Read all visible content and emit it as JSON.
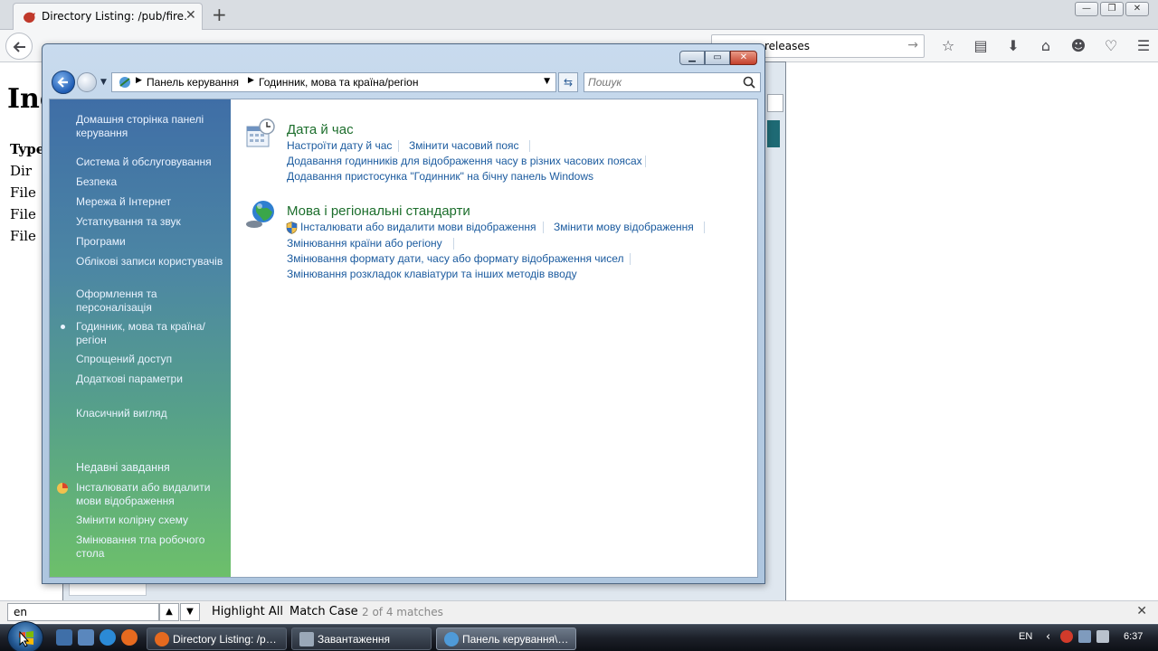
{
  "firefox": {
    "tab_title": "Directory Listing: /pub/fire…",
    "search_text": "releases",
    "page_heading": "Inc",
    "page_type_header": "Type",
    "rows": [
      "Dir",
      "File",
      "File",
      "File"
    ],
    "findbar": {
      "query": "en",
      "highlight_all": "Highlight All",
      "match_case": "Match Case",
      "status": "2 of 4 matches"
    }
  },
  "control_panel": {
    "breadcrumb": [
      "Панель керування",
      "Годинник, мова та країна/регіон"
    ],
    "search_placeholder": "Пошук",
    "sidebar": {
      "home": "Домашня сторінка панелі керування",
      "items": [
        "Система й обслуговування",
        "Безпека",
        "Мережа й Інтернет",
        "Устаткування та звук",
        "Програми",
        "Облікові записи користувачів",
        "Оформлення та персоналізація",
        "Годинник, мова та країна/регіон",
        "Спрощений доступ",
        "Додаткові параметри"
      ],
      "current_index": 7,
      "classic_view": "Класичний вигляд",
      "recent_tasks_header": "Недавні завдання",
      "recent_tasks": [
        "Інсталювати або видалити мови відображення",
        "Змінити колірну схему",
        "Змінювання тла робочого стола"
      ]
    },
    "categories": [
      {
        "title": "Дата й час",
        "icon": "calendar-clock-icon",
        "links": [
          "Настроїти дату й час",
          "Змінити часовий пояс",
          "Додавання годинників для відображення часу в різних часових поясах",
          "Додавання пристосунка \"Годинник\" на бічну панель Windows"
        ]
      },
      {
        "title": "Мова і регіональні стандарти",
        "icon": "globe-icon",
        "links": [
          "Інсталювати або видалити мови відображення",
          "Змінити мову відображення",
          "Змінювання країни або регіону",
          "Змінювання формату дати, часу або формату відображення чисел",
          "Змінювання розкладок клавіатури та інших методів вводу"
        ]
      }
    ]
  },
  "taskbar": {
    "buttons": [
      "Directory Listing: /p…",
      "Завантаження",
      "Панель керування\\…"
    ],
    "active_index": 2,
    "language": "EN",
    "clock": "6:37"
  },
  "colors": {
    "sidebar_top": "#3f6ea6",
    "sidebar_bottom": "#6dc06a",
    "category_title": "#1c6e2c",
    "link": "#1a5a9e"
  }
}
